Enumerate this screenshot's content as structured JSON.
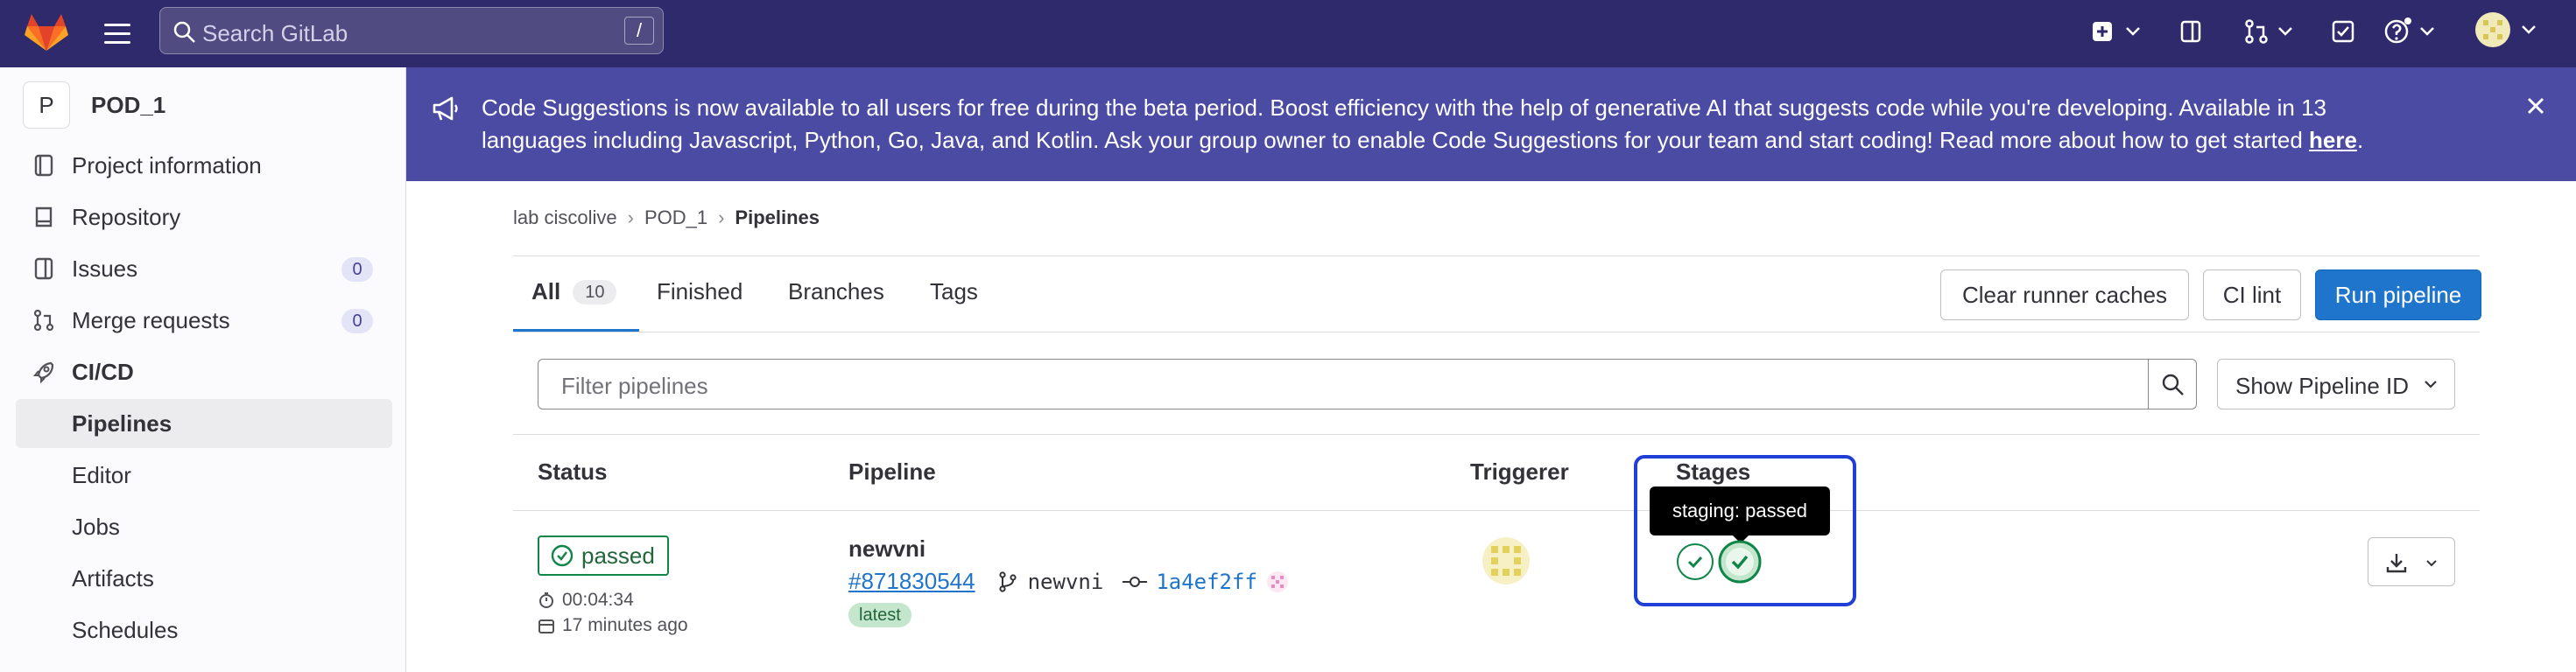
{
  "topbar": {
    "search_placeholder": "Search GitLab",
    "search_shortcut": "/",
    "icons": [
      "gitlab-logo",
      "hamburger-icon",
      "search-icon",
      "plus-square-icon",
      "issues-icon",
      "merge-requests-icon",
      "todo-icon",
      "help-icon",
      "user-avatar"
    ],
    "colors": {
      "background": "#2f2a6b"
    }
  },
  "sidebar": {
    "project_avatar_letter": "P",
    "project_name": "POD_1",
    "items": [
      {
        "label": "Project information",
        "icon": "project-info-icon"
      },
      {
        "label": "Repository",
        "icon": "repository-icon"
      },
      {
        "label": "Issues",
        "icon": "issues-icon",
        "count": "0"
      },
      {
        "label": "Merge requests",
        "icon": "merge-request-icon",
        "count": "0"
      },
      {
        "label": "CI/CD",
        "icon": "rocket-icon"
      }
    ],
    "subitems": [
      {
        "label": "Pipelines",
        "active": true
      },
      {
        "label": "Editor"
      },
      {
        "label": "Jobs"
      },
      {
        "label": "Artifacts"
      },
      {
        "label": "Schedules"
      }
    ]
  },
  "banner": {
    "text_line1": "Code Suggestions is now available to all users for free during the beta period. Boost efficiency with the help of generative AI that suggests code while you're developing. Available in 13",
    "text_line2": "languages including Javascript, Python, Go, Java, and Kotlin. Ask your group owner to enable Code Suggestions for your team and start coding! Read more about how to get started ",
    "link": "here",
    "trailing": ".",
    "colors": {
      "background": "#4b4ba3"
    }
  },
  "breadcrumb": [
    "lab ciscolive",
    "POD_1",
    "Pipelines"
  ],
  "tabs": [
    {
      "label": "All",
      "count": "10"
    },
    {
      "label": "Finished"
    },
    {
      "label": "Branches"
    },
    {
      "label": "Tags"
    }
  ],
  "actions": {
    "clear_caches": "Clear runner caches",
    "ci_lint": "CI lint",
    "run_pipeline": "Run pipeline"
  },
  "filter": {
    "placeholder": "Filter pipelines",
    "dropdown_label": "Show Pipeline ID"
  },
  "table": {
    "headers": {
      "status": "Status",
      "pipeline": "Pipeline",
      "triggerer": "Triggerer",
      "stages": "Stages"
    },
    "row": {
      "status": "passed",
      "duration": "00:04:34",
      "finished": "17 minutes ago",
      "name": "newvni",
      "id": "#871830544",
      "branch": "newvni",
      "commit": "1a4ef2ff",
      "tag": "latest",
      "stage_tooltip": "staging: passed"
    }
  }
}
